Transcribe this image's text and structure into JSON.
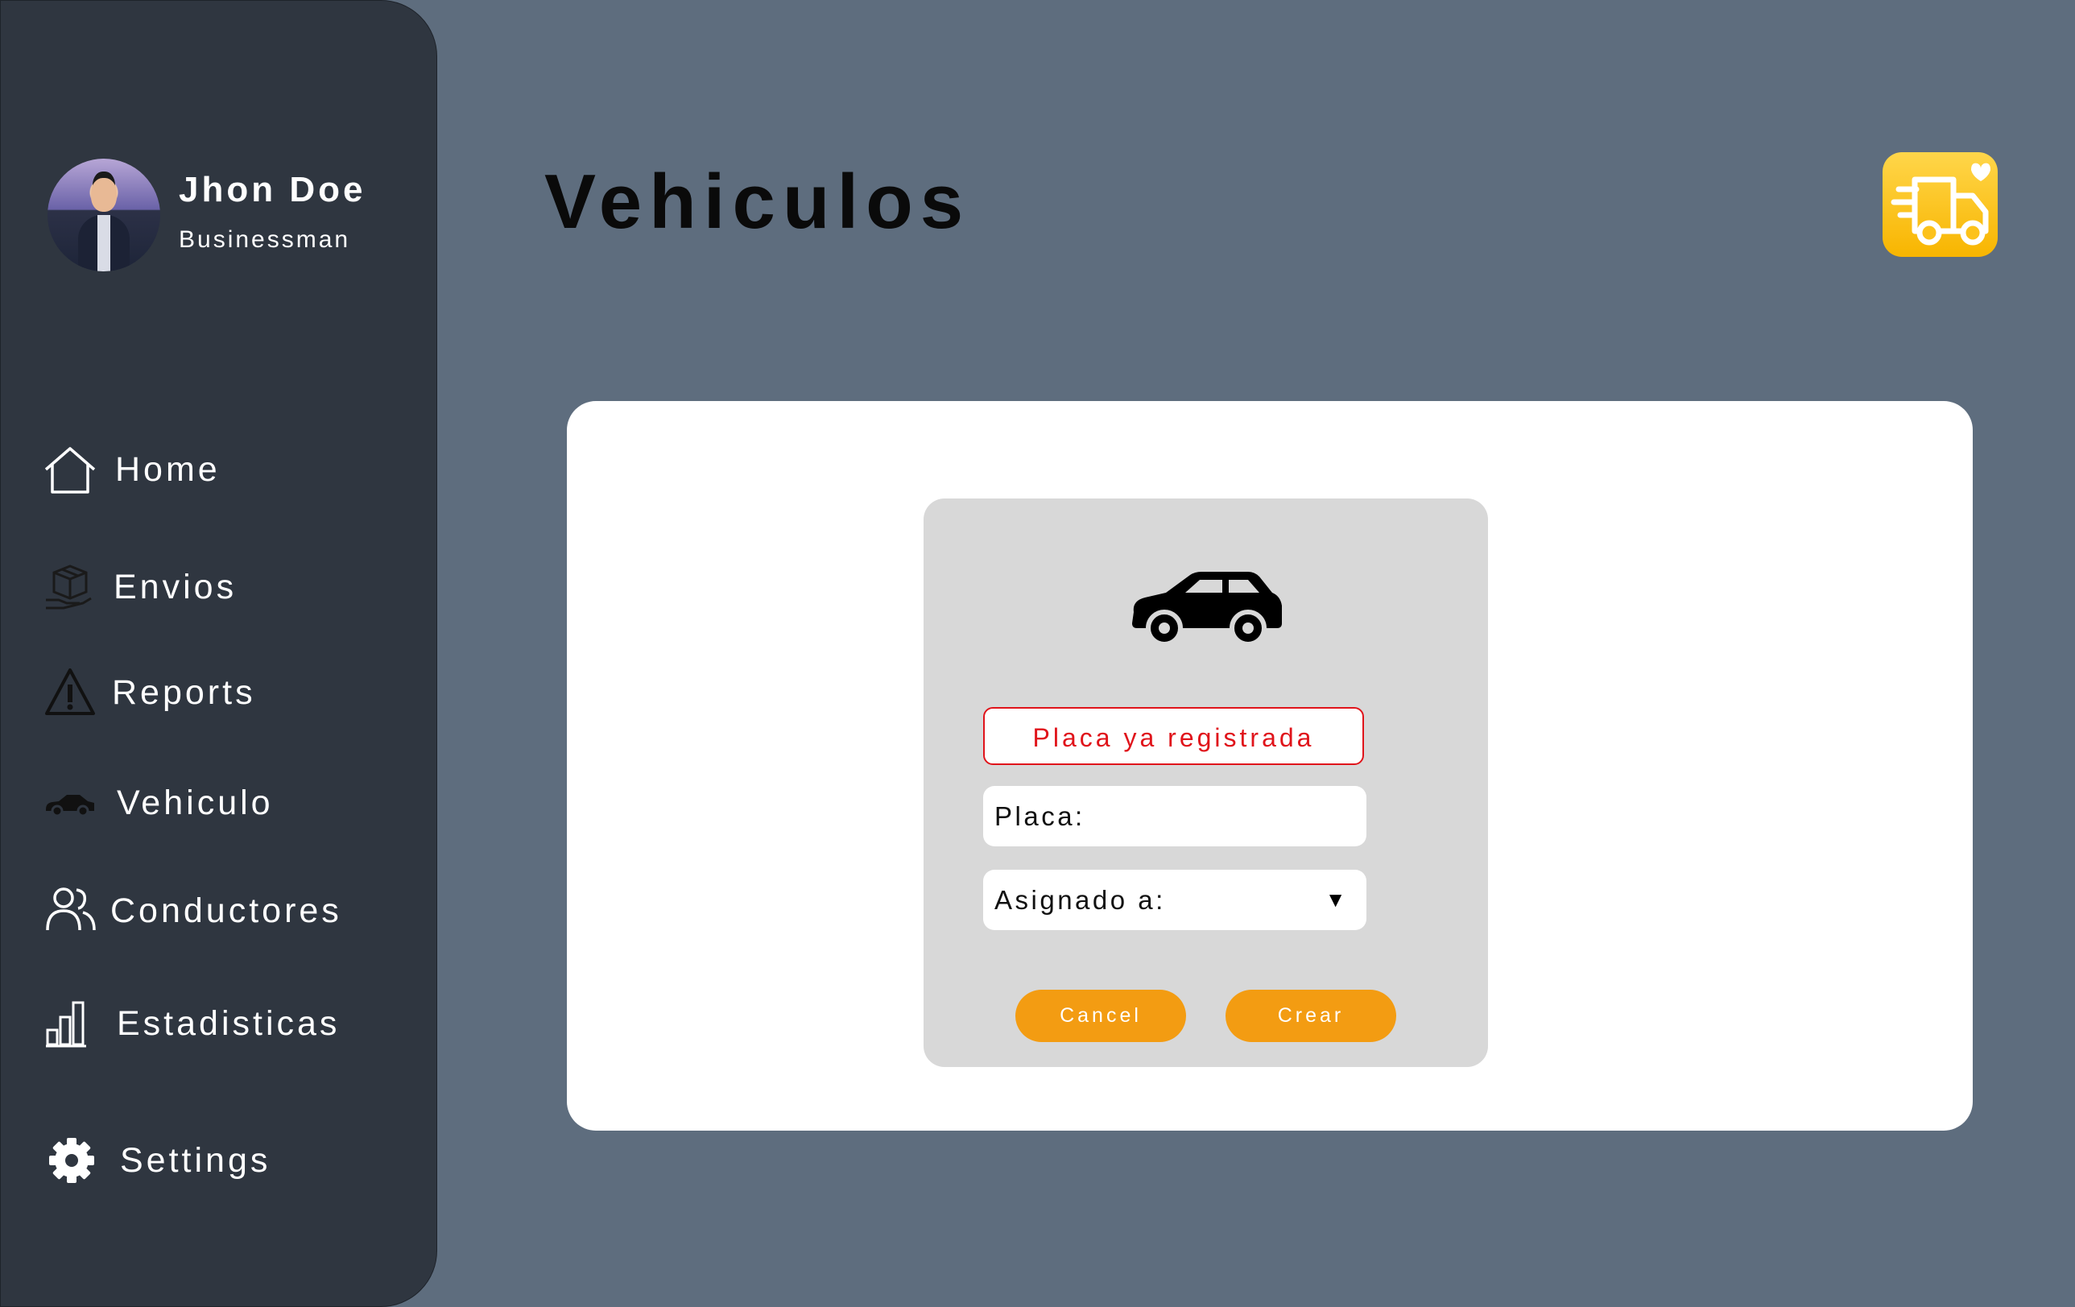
{
  "user": {
    "name": "Jhon Doe",
    "role": "Businessman"
  },
  "nav": {
    "home": "Home",
    "envios": "Envios",
    "reports": "Reports",
    "vehiculo": "Vehiculo",
    "conductores": "Conductores",
    "estadisticas": "Estadisticas",
    "settings": "Settings"
  },
  "page": {
    "title": "Vehiculos"
  },
  "form": {
    "error": "Placa ya registrada",
    "placa_label": "Placa:",
    "asignado_label": "Asignado a:",
    "cancel": "Cancel",
    "create": "Crear"
  },
  "icons": {
    "app_logo": "delivery-truck-heart-icon",
    "form_icon": "car-icon"
  },
  "colors": {
    "sidebar": "#2f3640",
    "background": "#5e6d7e",
    "accent": "#f39c12",
    "error": "#e0141b",
    "logo": "#fcc21b"
  }
}
